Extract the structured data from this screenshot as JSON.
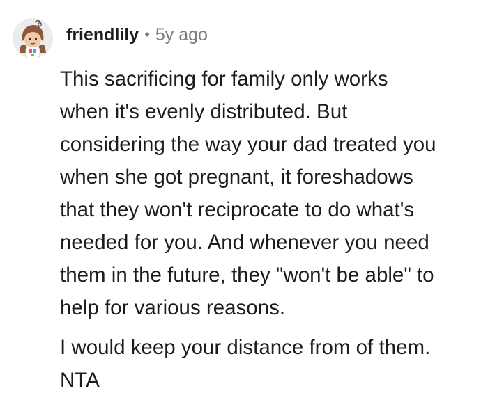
{
  "comment": {
    "username": "friendlily",
    "separator": "•",
    "time": "5y ago",
    "paragraphs": [
      "This sacrificing for family only works\nwhen it's evenly distributed. But\nconsidering the way your dad treated you\nwhen she got pregnant, it foreshadows\nthat they won't reciprocate to do what's\nneeded for you. And whenever you need\nthem in the future, they \"won't be able\" to\nhelp for various reasons.",
      "I would keep your distance from of them.\nNTA"
    ]
  },
  "colors": {
    "text": "#1c1c1c",
    "meta": "#7c7c7c",
    "avatar_bg": "#ececec",
    "avatar_skin": "#f2c9a7",
    "avatar_hair": "#8a5a3c"
  },
  "icons": {
    "avatar": "snoo-avatar-icon"
  }
}
